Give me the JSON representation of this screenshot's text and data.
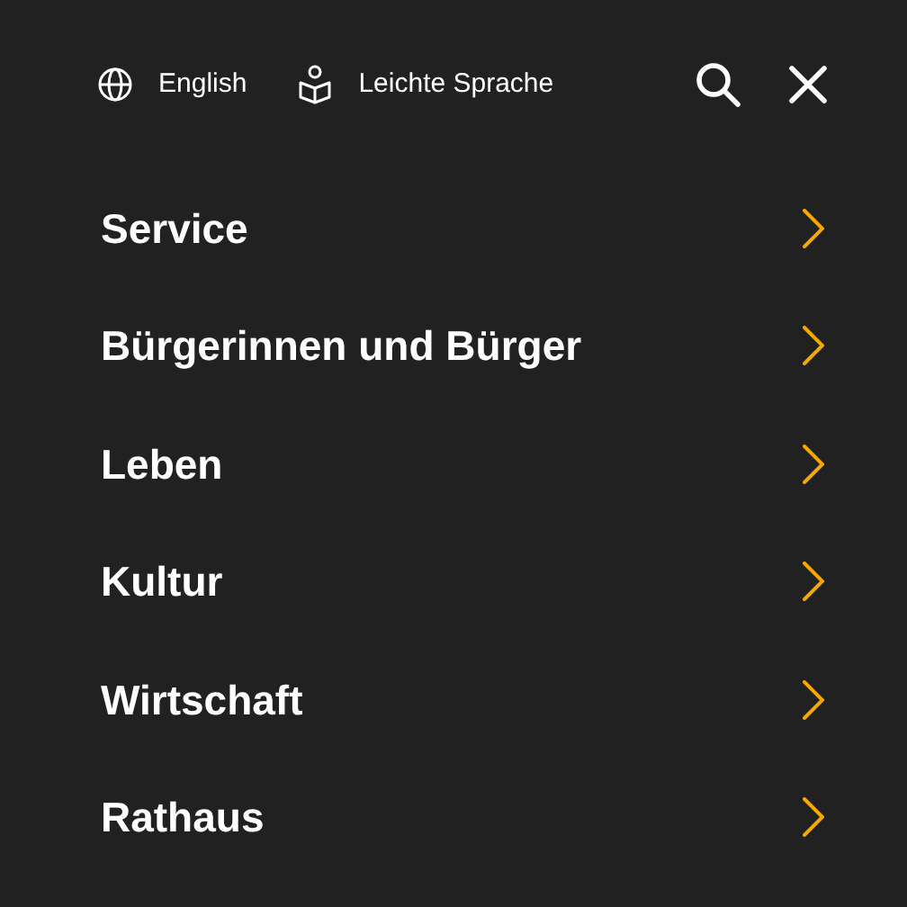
{
  "top_links": [
    {
      "kind": "language",
      "label": "English"
    },
    {
      "kind": "easy",
      "label": "Leichte Sprache"
    }
  ],
  "menu": [
    {
      "label": "Service"
    },
    {
      "label": "Bürgerinnen und Bürger"
    },
    {
      "label": "Leben"
    },
    {
      "label": "Kultur"
    },
    {
      "label": "Wirtschaft"
    },
    {
      "label": "Rathaus"
    }
  ]
}
